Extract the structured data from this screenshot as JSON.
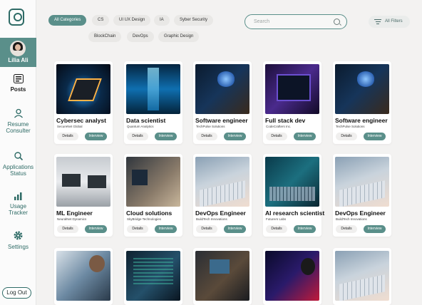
{
  "sidebar": {
    "profile_name": "Lilia Ali",
    "items": [
      {
        "label": "Posts"
      },
      {
        "label": "Resume Consulter"
      },
      {
        "label": "Applications Status"
      },
      {
        "label": "Usage Tracker"
      },
      {
        "label": "Settings"
      }
    ],
    "logout_label": "Log Out"
  },
  "categories": [
    "All Categories",
    "CS",
    "UI UX Design",
    "IA",
    "Syber Security",
    "BlockChain",
    "DevOps",
    "Graphic Design"
  ],
  "search": {
    "placeholder": "Search"
  },
  "filters_label": "All Filters",
  "card_buttons": {
    "details": "Details",
    "interview": "Interview"
  },
  "cards": [
    {
      "title": "Cybersec analyst",
      "company": "SecureNet Global"
    },
    {
      "title": "Data scientist",
      "company": "Quantum Analytics"
    },
    {
      "title": "Software engineer",
      "company": "TechPulse Solutions"
    },
    {
      "title": "Full stack dev",
      "company": "CodeCrafters Inc."
    },
    {
      "title": "Software engineer",
      "company": "TechPulse Solutions"
    },
    {
      "title": "ML Engineer",
      "company": "NeuralNet Dynamics"
    },
    {
      "title": "Cloud solutions",
      "company": "SkyBridge Technologies"
    },
    {
      "title": "DevOps Engineer",
      "company": "BuildTech Innovations"
    },
    {
      "title": "AI research scientist",
      "company": "FutureAI Labs"
    },
    {
      "title": "DevOps Engineer",
      "company": "BuildTech Innovations"
    }
  ],
  "colors": {
    "accent": "#5a8f8a",
    "accent_dark": "#2e6b66",
    "background": "#f3f2f1"
  }
}
